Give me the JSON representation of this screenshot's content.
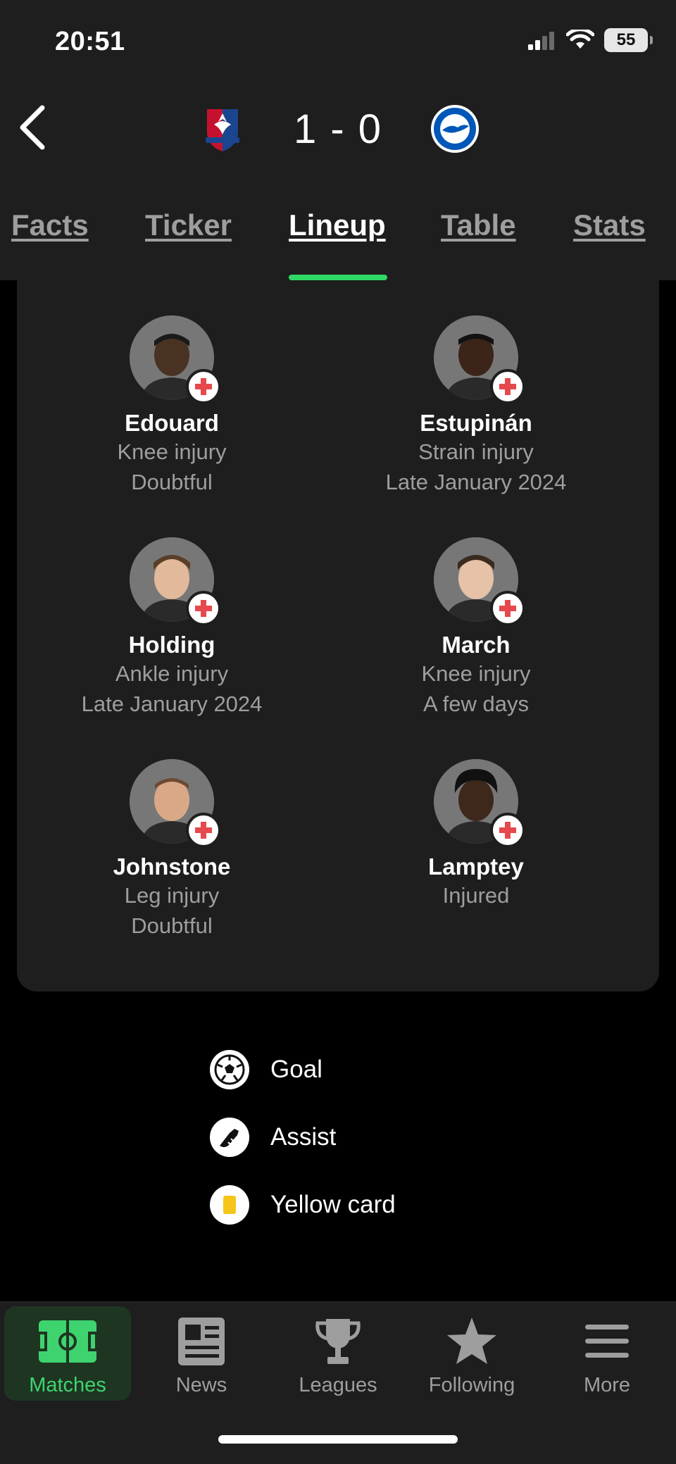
{
  "status_bar": {
    "time": "20:51",
    "battery": "55"
  },
  "match": {
    "score": "1 - 0",
    "home_team": "Crystal Palace",
    "away_team": "Brighton & Hove Albion"
  },
  "tabs": [
    {
      "label": "Facts",
      "active": false
    },
    {
      "label": "Ticker",
      "active": false
    },
    {
      "label": "Lineup",
      "active": true
    },
    {
      "label": "Table",
      "active": false
    },
    {
      "label": "Stats",
      "active": false
    }
  ],
  "injured_players": [
    {
      "name": "Edouard",
      "injury": "Knee injury",
      "return": "Doubtful",
      "skin": "#4a3222"
    },
    {
      "name": "Estupinán",
      "injury": "Strain injury",
      "return": "Late January 2024",
      "skin": "#3c2419"
    },
    {
      "name": "Holding",
      "injury": "Ankle injury",
      "return": "Late January 2024",
      "skin": "#e2b99a"
    },
    {
      "name": "March",
      "injury": "Knee injury",
      "return": "A few days",
      "skin": "#e5c2a8"
    },
    {
      "name": "Johnstone",
      "injury": "Leg injury",
      "return": "Doubtful",
      "skin": "#d9a987"
    },
    {
      "name": "Lamptey",
      "injury": "Injured",
      "return": "",
      "skin": "#3e271b"
    }
  ],
  "legend": [
    {
      "label": "Goal",
      "icon": "soccer-ball-icon"
    },
    {
      "label": "Assist",
      "icon": "boot-icon"
    },
    {
      "label": "Yellow card",
      "icon": "yellow-card-icon"
    }
  ],
  "bottom_nav": [
    {
      "label": "Matches",
      "icon": "pitch-icon",
      "active": true
    },
    {
      "label": "News",
      "icon": "newspaper-icon",
      "active": false
    },
    {
      "label": "Leagues",
      "icon": "trophy-icon",
      "active": false
    },
    {
      "label": "Following",
      "icon": "star-icon",
      "active": false
    },
    {
      "label": "More",
      "icon": "menu-icon",
      "active": false
    }
  ],
  "colors": {
    "accent": "#2fd765",
    "card": "#1e1e1e",
    "injury_red": "#e5484d",
    "yellow_card": "#f5c518"
  }
}
